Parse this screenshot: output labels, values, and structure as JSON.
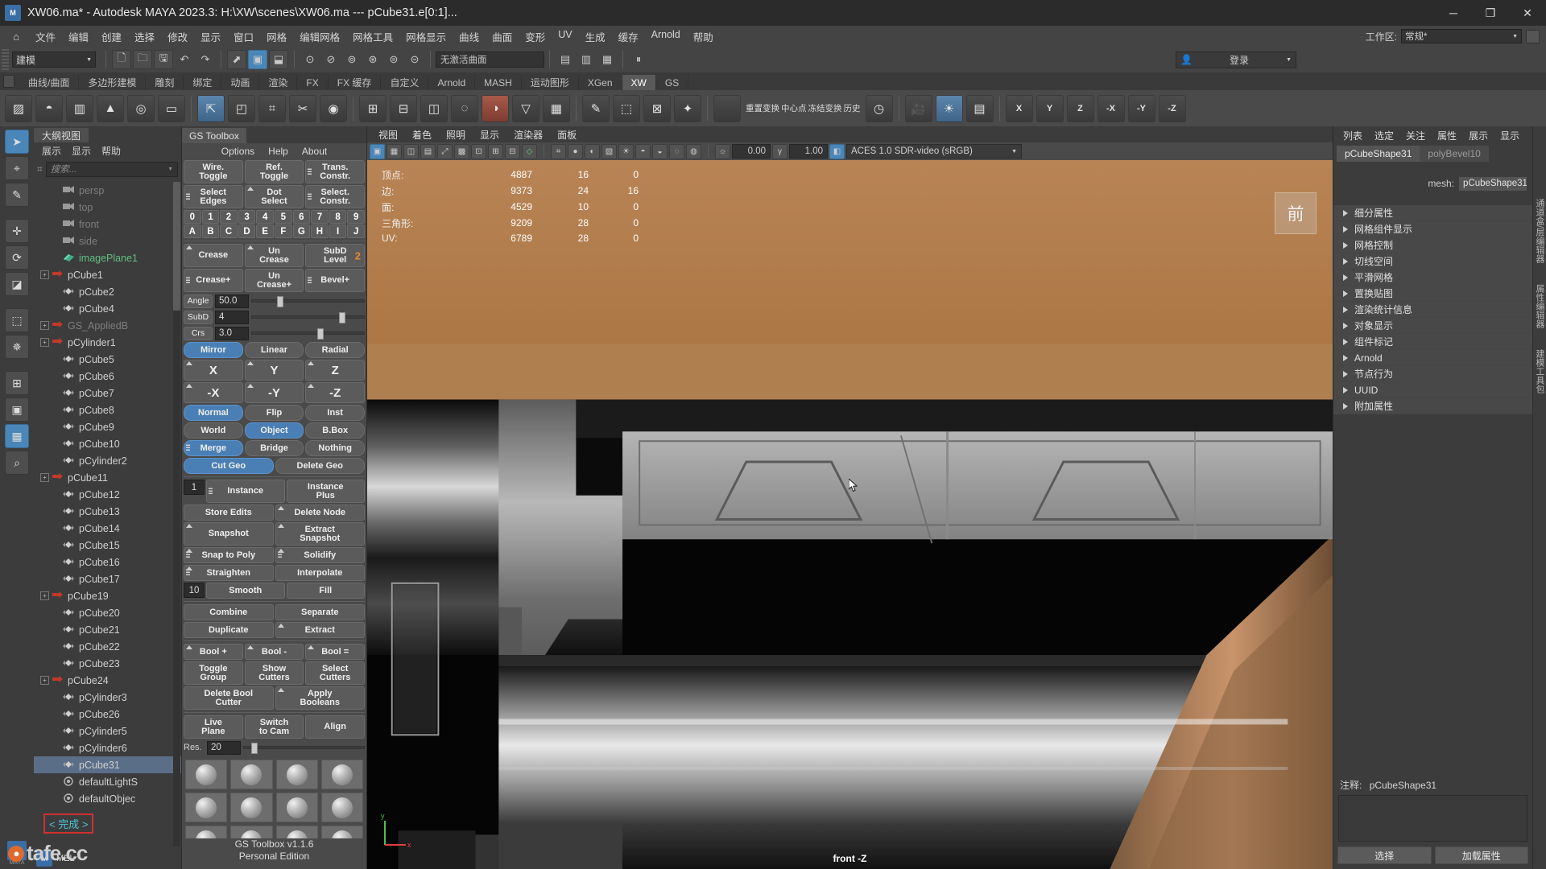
{
  "titlebar": {
    "title": "XW06.ma* - Autodesk MAYA 2023.3: H:\\XW\\scenes\\XW06.ma   ---   pCube31.e[0:1]...",
    "app_badge": "M",
    "app_badge_sub": "AYA",
    "minimize": "─",
    "maximize": "❐",
    "close": "✕"
  },
  "menubar": {
    "home_icon": "⌂",
    "items": [
      "文件",
      "编辑",
      "创建",
      "选择",
      "修改",
      "显示",
      "窗口",
      "网格",
      "编辑网格",
      "网格工具",
      "网格显示",
      "曲线",
      "曲面",
      "变形",
      "UV",
      "生成",
      "缓存",
      "Arnold",
      "帮助"
    ],
    "workspace_label": "工作区:",
    "workspace_value": "常规*"
  },
  "statusline": {
    "mode_value": "建模",
    "surface_field": "无激活曲面",
    "login_label": "登录",
    "icons": [
      "new-scene-icon",
      "open-scene-icon",
      "save-scene-icon",
      "undo-icon",
      "redo-icon",
      "select-by-hierarchy-icon",
      "select-by-object-icon",
      "select-by-component-icon",
      "snap-to-grid-icon",
      "snap-to-curve-icon",
      "snap-to-point-icon",
      "snap-to-projected-icon",
      "snap-to-view-plane-icon",
      "make-live-icon",
      "render-icon",
      "ipr-icon",
      "render-settings-icon",
      "pause-icon",
      "person-icon"
    ]
  },
  "shelf": {
    "tabs": [
      "曲线/曲面",
      "多边形建模",
      "雕刻",
      "绑定",
      "动画",
      "渲染",
      "FX",
      "FX 缓存",
      "自定义",
      "Arnold",
      "MASH",
      "运动图形",
      "XGen",
      "XW",
      "GS"
    ],
    "active_tab": "XW",
    "labels": {
      "reset": "重置变换",
      "center_pivot": "中心点",
      "freeze": "冻结变换",
      "history": "历史",
      "x": "X",
      "y": "Y",
      "z": "Z",
      "nx": "-X",
      "ny": "-Y",
      "nz": "-Z"
    },
    "icons": [
      "cube-icon",
      "sphere-icon",
      "cylinder-icon",
      "cone-icon",
      "torus-icon",
      "plane-icon",
      "extrude-icon",
      "bevel-icon",
      "bridge-icon",
      "combine-icon",
      "separate-icon",
      "mirror-icon",
      "boolean-icon",
      "smooth-icon",
      "reduce-icon",
      "quadrangulate-icon",
      "triangulate-icon",
      "sculpt-icon",
      "uv-editor-icon",
      "lattice-icon",
      "cluster-icon",
      "light-icon",
      "camera-icon"
    ]
  },
  "tool_column": {
    "items": [
      {
        "name": "select-tool",
        "icon": "➤",
        "active": true
      },
      {
        "name": "lasso-tool",
        "icon": "⌖",
        "active": false
      },
      {
        "name": "paint-select-tool",
        "icon": "✎",
        "active": false
      },
      {
        "name": "move-tool",
        "icon": "✛",
        "active": false
      },
      {
        "name": "rotate-tool",
        "icon": "⟳",
        "active": false
      },
      {
        "name": "scale-tool",
        "icon": "◪",
        "active": false
      },
      {
        "name": "last-tool",
        "icon": "⬚",
        "active": false
      },
      {
        "name": "snap-axis-tool",
        "icon": "✵",
        "active": false
      },
      {
        "name": "grid-layout-tool",
        "icon": "⊞",
        "active": false
      },
      {
        "name": "single-pane-layout",
        "icon": "▣",
        "active": false
      },
      {
        "name": "four-pane-layout",
        "icon": "▦",
        "active": true
      },
      {
        "name": "zoom-tool",
        "icon": "⌕",
        "active": false
      }
    ],
    "maya_badge": "M",
    "maya_caption": "MAYA"
  },
  "outliner": {
    "tab": "大纲视图",
    "menu": [
      "展示",
      "显示",
      "帮助"
    ],
    "search_placeholder": "搜索...",
    "search_icon": "filter-icon",
    "items": [
      {
        "label": "persp",
        "type": "camera",
        "expand": false,
        "indent": 1,
        "style": "dim"
      },
      {
        "label": "top",
        "type": "camera",
        "expand": false,
        "indent": 1,
        "style": "dim"
      },
      {
        "label": "front",
        "type": "camera",
        "expand": false,
        "indent": 1,
        "style": "dim"
      },
      {
        "label": "side",
        "type": "camera",
        "expand": false,
        "indent": 1,
        "style": "dim"
      },
      {
        "label": "imagePlane1",
        "type": "imageplane",
        "expand": false,
        "indent": 1,
        "style": "green"
      },
      {
        "label": "pCube1",
        "type": "transform",
        "expand": true,
        "indent": 0,
        "style": "normal"
      },
      {
        "label": "pCube2",
        "type": "mesh",
        "expand": false,
        "indent": 1,
        "style": "normal"
      },
      {
        "label": "pCube4",
        "type": "mesh",
        "expand": false,
        "indent": 1,
        "style": "normal"
      },
      {
        "label": "GS_AppliedB",
        "type": "transform",
        "expand": true,
        "indent": 0,
        "style": "dim"
      },
      {
        "label": "pCylinder1",
        "type": "transform",
        "expand": true,
        "indent": 0,
        "style": "normal"
      },
      {
        "label": "pCube5",
        "type": "mesh",
        "expand": false,
        "indent": 1,
        "style": "normal"
      },
      {
        "label": "pCube6",
        "type": "mesh",
        "expand": false,
        "indent": 1,
        "style": "normal"
      },
      {
        "label": "pCube7",
        "type": "mesh",
        "expand": false,
        "indent": 1,
        "style": "normal"
      },
      {
        "label": "pCube8",
        "type": "mesh",
        "expand": false,
        "indent": 1,
        "style": "normal"
      },
      {
        "label": "pCube9",
        "type": "mesh",
        "expand": false,
        "indent": 1,
        "style": "normal"
      },
      {
        "label": "pCube10",
        "type": "mesh",
        "expand": false,
        "indent": 1,
        "style": "normal"
      },
      {
        "label": "pCylinder2",
        "type": "mesh",
        "expand": false,
        "indent": 1,
        "style": "normal"
      },
      {
        "label": "pCube11",
        "type": "transform",
        "expand": true,
        "indent": 0,
        "style": "normal"
      },
      {
        "label": "pCube12",
        "type": "mesh",
        "expand": false,
        "indent": 1,
        "style": "normal"
      },
      {
        "label": "pCube13",
        "type": "mesh",
        "expand": false,
        "indent": 1,
        "style": "normal"
      },
      {
        "label": "pCube14",
        "type": "mesh",
        "expand": false,
        "indent": 1,
        "style": "normal"
      },
      {
        "label": "pCube15",
        "type": "mesh",
        "expand": false,
        "indent": 1,
        "style": "normal"
      },
      {
        "label": "pCube16",
        "type": "mesh",
        "expand": false,
        "indent": 1,
        "style": "normal"
      },
      {
        "label": "pCube17",
        "type": "mesh",
        "expand": false,
        "indent": 1,
        "style": "normal"
      },
      {
        "label": "pCube19",
        "type": "transform",
        "expand": true,
        "indent": 0,
        "style": "normal"
      },
      {
        "label": "pCube20",
        "type": "mesh",
        "expand": false,
        "indent": 1,
        "style": "normal"
      },
      {
        "label": "pCube21",
        "type": "mesh",
        "expand": false,
        "indent": 1,
        "style": "normal"
      },
      {
        "label": "pCube22",
        "type": "mesh",
        "expand": false,
        "indent": 1,
        "style": "normal"
      },
      {
        "label": "pCube23",
        "type": "mesh",
        "expand": false,
        "indent": 1,
        "style": "normal"
      },
      {
        "label": "pCube24",
        "type": "transform",
        "expand": true,
        "indent": 0,
        "style": "normal"
      },
      {
        "label": "pCylinder3",
        "type": "mesh",
        "expand": false,
        "indent": 1,
        "style": "normal"
      },
      {
        "label": "pCube26",
        "type": "mesh",
        "expand": false,
        "indent": 1,
        "style": "normal"
      },
      {
        "label": "pCylinder5",
        "type": "mesh",
        "expand": false,
        "indent": 1,
        "style": "normal"
      },
      {
        "label": "pCylinder6",
        "type": "mesh",
        "expand": false,
        "indent": 1,
        "style": "normal"
      },
      {
        "label": "pCube31",
        "type": "mesh",
        "expand": false,
        "indent": 1,
        "style": "selected"
      },
      {
        "label": "defaultLightS",
        "type": "set",
        "expand": false,
        "indent": 1,
        "style": "normal"
      },
      {
        "label": "defaultObjec",
        "type": "set",
        "expand": false,
        "indent": 1,
        "style": "normal"
      }
    ],
    "command_hint": "< 完成 >",
    "mel_label": "MEL",
    "mel_badge": "M"
  },
  "gs_toolbox": {
    "tab": "GS Toolbox",
    "menu": [
      "Options",
      "Help",
      "About"
    ],
    "row1": [
      {
        "label": "Wire.\nToggle",
        "name": "wire-toggle-button",
        "state": "off",
        "marker": "none"
      },
      {
        "label": "Ref.\nToggle",
        "name": "ref-toggle-button",
        "state": "off",
        "marker": "none"
      },
      {
        "label": "Trans.\nConstr.",
        "name": "trans-constr-button",
        "state": "off",
        "marker": "dots"
      }
    ],
    "row2": [
      {
        "label": "Select\nEdges",
        "name": "select-edges-button",
        "state": "off",
        "marker": "dots"
      },
      {
        "label": "Dot\nSelect",
        "name": "dot-select-button",
        "state": "off",
        "marker": "tri"
      },
      {
        "label": "Select.\nConstr.",
        "name": "select-constr-button",
        "state": "off",
        "marker": "dots"
      }
    ],
    "numbers": [
      "0",
      "1",
      "2",
      "3",
      "4",
      "5",
      "6",
      "7",
      "8",
      "9"
    ],
    "letters": [
      "A",
      "B",
      "C",
      "D",
      "E",
      "F",
      "G",
      "H",
      "I",
      "J"
    ],
    "row3": [
      {
        "label": "Crease",
        "name": "crease-button",
        "marker": "tri"
      },
      {
        "label": "Un\nCrease",
        "name": "uncrease-button",
        "marker": "tri"
      },
      {
        "label": "SubD\nLevel",
        "name": "subd-level-button",
        "marker": "none",
        "badge": "2"
      }
    ],
    "row4": [
      {
        "label": "Crease+",
        "name": "crease-plus-button",
        "marker": "dots"
      },
      {
        "label": "Un\nCrease+",
        "name": "uncrease-plus-button",
        "marker": "none"
      },
      {
        "label": "Bevel+",
        "name": "bevel-plus-button",
        "marker": "dots"
      }
    ],
    "sliders": [
      {
        "label": "Angle",
        "value": "50.0",
        "name": "angle-slider",
        "pct": 22
      },
      {
        "label": "SubD",
        "value": "4",
        "name": "subd-slider",
        "pct": 78
      },
      {
        "label": "Crs",
        "value": "3.0",
        "name": "crs-slider",
        "pct": 58
      }
    ],
    "mirror_row": [
      {
        "label": "Mirror",
        "name": "mirror-button",
        "state": "on"
      },
      {
        "label": "Linear",
        "name": "linear-button",
        "state": "off"
      },
      {
        "label": "Radial",
        "name": "radial-button",
        "state": "off"
      }
    ],
    "axis_row1": [
      {
        "label": "X",
        "name": "axis-x-button"
      },
      {
        "label": "Y",
        "name": "axis-y-button"
      },
      {
        "label": "Z",
        "name": "axis-z-button"
      }
    ],
    "axis_row2": [
      {
        "label": "-X",
        "name": "axis-neg-x-button"
      },
      {
        "label": "-Y",
        "name": "axis-neg-y-button"
      },
      {
        "label": "-Z",
        "name": "axis-neg-z-button"
      }
    ],
    "normal_row": [
      {
        "label": "Normal",
        "name": "normal-button",
        "state": "on"
      },
      {
        "label": "Flip",
        "name": "flip-button",
        "state": "off"
      },
      {
        "label": "Inst",
        "name": "inst-button",
        "state": "off"
      }
    ],
    "space_row": [
      {
        "label": "World",
        "name": "world-button",
        "state": "off"
      },
      {
        "label": "Object",
        "name": "object-button",
        "state": "on"
      },
      {
        "label": "B.Box",
        "name": "bbox-button",
        "state": "off"
      }
    ],
    "merge_row": [
      {
        "label": "Merge",
        "name": "merge-button",
        "state": "on",
        "marker": "dots"
      },
      {
        "label": "Bridge",
        "name": "bridge-button",
        "state": "off"
      },
      {
        "label": "Nothing",
        "name": "nothing-button",
        "state": "off"
      }
    ],
    "cut_row": [
      {
        "label": "Cut Geo",
        "name": "cut-geo-button",
        "state": "on"
      },
      {
        "label": "Delete Geo",
        "name": "delete-geo-button",
        "state": "off"
      }
    ],
    "instance_field": "1",
    "instance_row": [
      {
        "label": "Instance",
        "name": "instance-button",
        "marker": "dots"
      },
      {
        "label": "Instance\nPlus",
        "name": "instance-plus-button",
        "marker": "none"
      }
    ],
    "pairs": [
      [
        {
          "label": "Store Edits",
          "name": "store-edits-button",
          "marker": "none"
        },
        {
          "label": "Delete Node",
          "name": "delete-node-button",
          "marker": "tri"
        }
      ],
      [
        {
          "label": "Snapshot",
          "name": "snapshot-button",
          "marker": "tri"
        },
        {
          "label": "Extract\nSnapshot",
          "name": "extract-snapshot-button",
          "marker": "tri"
        }
      ],
      [
        {
          "label": "Snap to Poly",
          "name": "snap-to-poly-button",
          "marker": "both"
        },
        {
          "label": "Solidify",
          "name": "solidify-button",
          "marker": "both"
        }
      ],
      [
        {
          "label": "Straighten",
          "name": "straighten-button",
          "marker": "both"
        },
        {
          "label": "Interpolate",
          "name": "interpolate-button",
          "marker": "none"
        }
      ]
    ],
    "smooth_field": "10",
    "smooth_row": [
      {
        "label": "Smooth",
        "name": "smooth-button"
      },
      {
        "label": "Fill",
        "name": "fill-button"
      }
    ],
    "combine_row": [
      {
        "label": "Combine",
        "name": "combine-button",
        "marker": "none"
      },
      {
        "label": "Separate",
        "name": "separate-button",
        "marker": "none"
      }
    ],
    "duplicate_row": [
      {
        "label": "Duplicate",
        "name": "duplicate-button",
        "marker": "none"
      },
      {
        "label": "Extract",
        "name": "extract-button",
        "marker": "tri"
      }
    ],
    "bool_row": [
      {
        "label": "Bool +",
        "name": "bool-plus-button",
        "marker": "tri"
      },
      {
        "label": "Bool -",
        "name": "bool-minus-button",
        "marker": "tri"
      },
      {
        "label": "Bool =",
        "name": "bool-equals-button",
        "marker": "tri"
      }
    ],
    "cutter_row": [
      {
        "label": "Toggle\nGroup",
        "name": "toggle-group-button"
      },
      {
        "label": "Show\nCutters",
        "name": "show-cutters-button"
      },
      {
        "label": "Select\nCutters",
        "name": "select-cutters-button"
      }
    ],
    "bool_row2": [
      {
        "label": "Delete Bool\nCutter",
        "name": "delete-bool-cutter-button",
        "marker": "none"
      },
      {
        "label": "Apply\nBooleans",
        "name": "apply-booleans-button",
        "marker": "tri"
      }
    ],
    "plane_row": [
      {
        "label": "Live\nPlane",
        "name": "live-plane-button"
      },
      {
        "label": "Switch\nto Cam",
        "name": "switch-to-cam-button"
      },
      {
        "label": "Align",
        "name": "align-button"
      }
    ],
    "res_label": "Res.",
    "res_value": "20",
    "res_pct": 6,
    "footer_line1": "GS Toolbox v1.1.6",
    "footer_line2": "Personal Edition"
  },
  "viewport": {
    "menu": [
      "视图",
      "着色",
      "照明",
      "显示",
      "渲染器",
      "面板"
    ],
    "exposure": "0.00",
    "gamma": "1.00",
    "color_profile": "ACES 1.0 SDR-video (sRGB)",
    "hud": {
      "rows": [
        {
          "label": "顶点:",
          "total": "4887",
          "b": "16",
          "c": "0"
        },
        {
          "label": "边:",
          "total": "9373",
          "b": "24",
          "c": "16"
        },
        {
          "label": "面:",
          "total": "4529",
          "b": "10",
          "c": "0"
        },
        {
          "label": "三角形:",
          "total": "9209",
          "b": "28",
          "c": "0"
        },
        {
          "label": "UV:",
          "total": "6789",
          "b": "28",
          "c": "0"
        }
      ]
    },
    "orient_gizmo": "前",
    "camera_label": "front -Z",
    "axis_y": "y",
    "axis_x": "x",
    "cursor_icon": "arrow-cursor"
  },
  "right_panel": {
    "menu": [
      "列表",
      "选定",
      "关注",
      "属性",
      "展示",
      "显示"
    ],
    "tabs": [
      {
        "label": "pCubeShape31",
        "active": true
      },
      {
        "label": "polyBevel10",
        "active": false
      }
    ],
    "mesh_label": "mesh:",
    "mesh_value": "pCubeShape31",
    "sections": [
      "细分属性",
      "网格组件显示",
      "网格控制",
      "切线空间",
      "平滑网格",
      "置换贴图",
      "渲染统计信息",
      "对象显示",
      "组件标记",
      "Arnold",
      "节点行为",
      "UUID",
      "附加属性"
    ],
    "note_label": "注释:",
    "note_value": "pCubeShape31",
    "buttons": [
      "选择",
      "加载属性"
    ],
    "vertical_tabs": [
      "通道盒/层编辑器",
      "属性编辑器",
      "建模工具包"
    ]
  },
  "watermark": {
    "text": "tafe.cc",
    "badge": "●"
  }
}
